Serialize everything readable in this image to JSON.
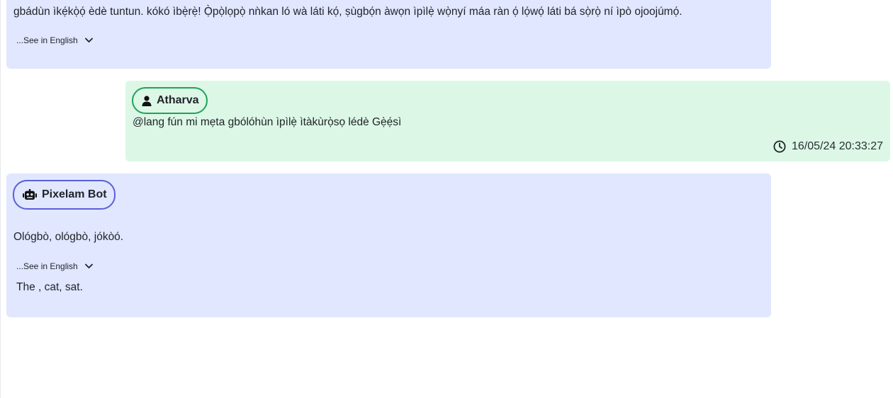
{
  "messages": [
    {
      "type": "bot",
      "text": "gbádùn ìkẹ́kọ̀ọ́ èdè tuntun. kókó ìbẹ̀rẹ̀! Ọ̀pọ̀lọpọ̀ nǹkan ló wà láti kọ́, ṣùgbọ́n àwọn ìpìlẹ̀ wọ̀nyí máa ràn ọ́ lọ́wọ́ láti bá sọ̀rọ̀ ní ìpò ojoojúmọ́.",
      "see_label": "...See in English"
    },
    {
      "type": "user",
      "author": "Atharva",
      "text": "@lang fún mi mẹta gbólóhùn ìpìlẹ̀ ìtàkùrọ̀sọ lédè Gẹ̀ẹ́sì",
      "timestamp": "16/05/24 20:33:27"
    },
    {
      "type": "bot",
      "author": "Pixelam Bot",
      "text": "Ológbò, ológbò, jókòó.",
      "see_label": "...See in English",
      "translation": "The , cat, sat."
    }
  ],
  "colors": {
    "bot_bubble": "#e0e7ff",
    "user_bubble": "#dcf7e6",
    "user_pill_border": "#22a25c",
    "bot_pill_border": "#5b5fd6"
  },
  "icons": {
    "user": "user-icon",
    "bot": "robot-icon",
    "clock": "clock-icon",
    "chevron": "chevron-down-icon"
  }
}
